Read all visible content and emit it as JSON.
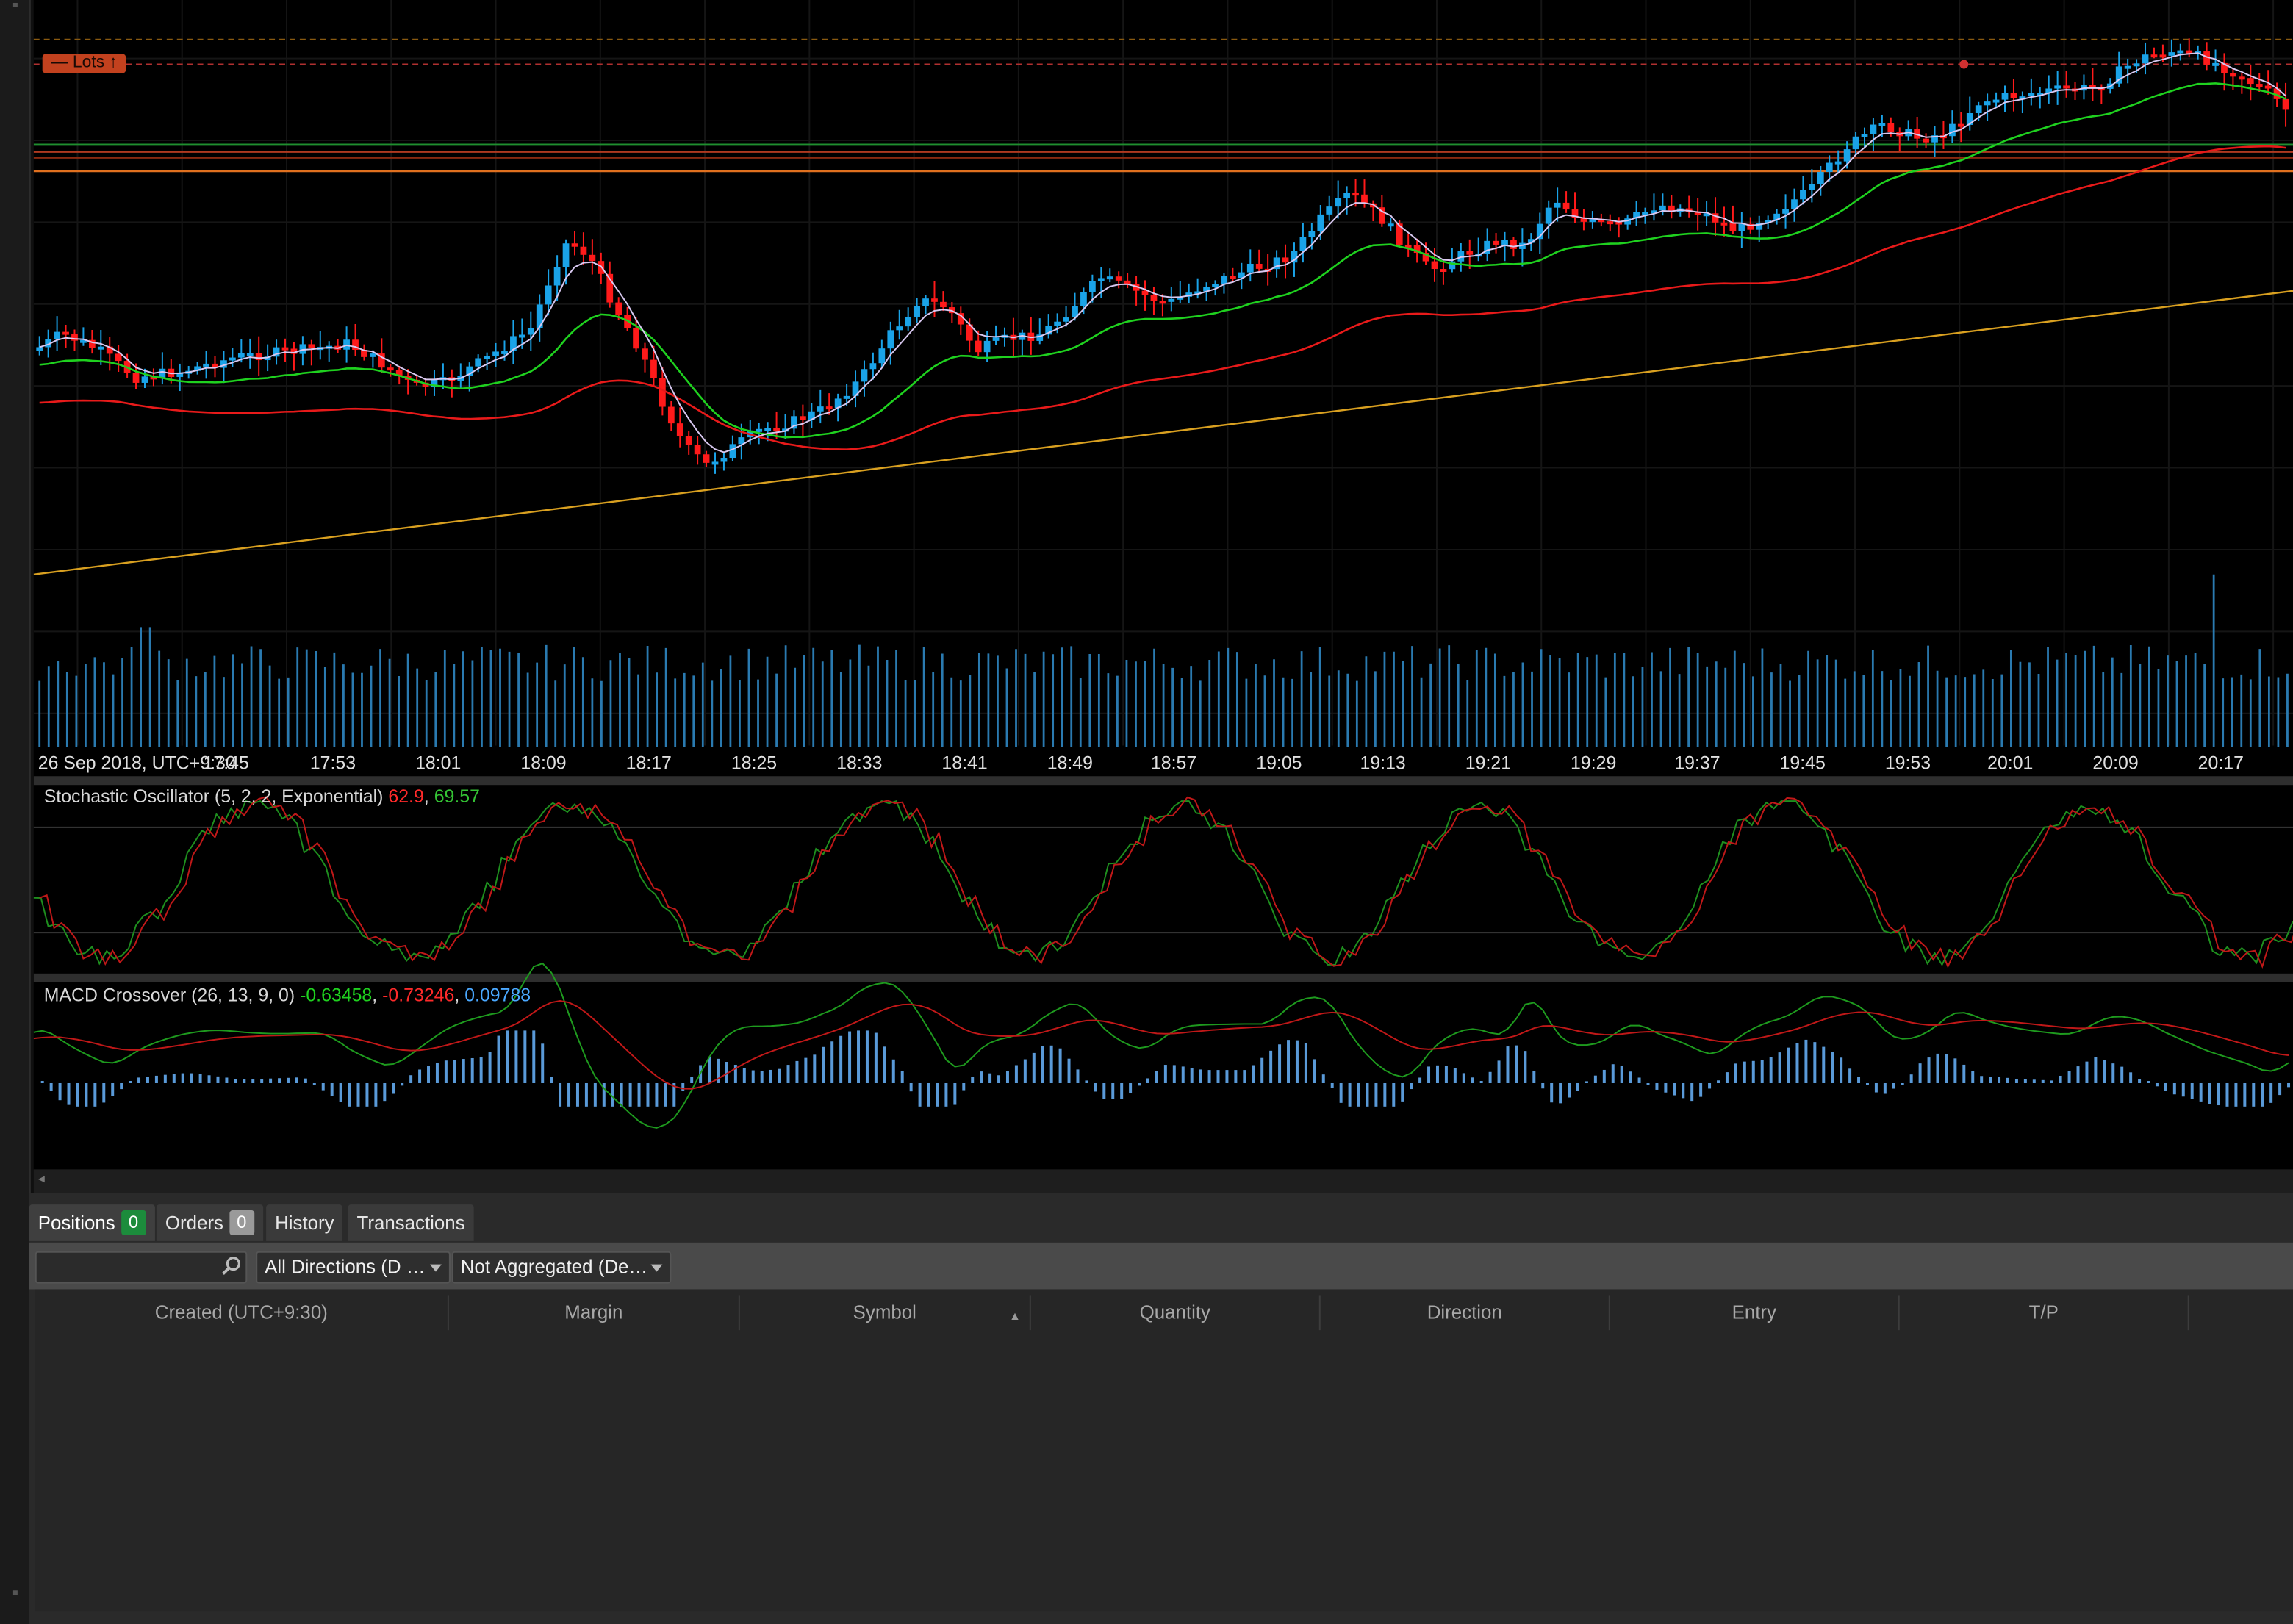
{
  "chart": {
    "date_label": "26 Sep 2018, UTC+9:30",
    "time_ticks": [
      "17:45",
      "17:53",
      "18:01",
      "18:09",
      "18:17",
      "18:25",
      "18:33",
      "18:41",
      "18:49",
      "18:57",
      "19:05",
      "19:13",
      "19:21",
      "19:29",
      "19:37",
      "19:45",
      "19:53",
      "20:01",
      "20:09",
      "20:17"
    ],
    "lots_tag": "— Lots",
    "lots_arrow": "↑",
    "colors": {
      "bull": "#1aa3e8",
      "bear": "#ff1a1a",
      "ma_fast": "#d8c8f0",
      "ma_mid": "#1fd11f",
      "ma_slow": "#e81a1a",
      "trendline": "#d9a020",
      "hline_orange": "#e0701f",
      "hline_green": "#1f8f2f",
      "volume": "#2a7ab0"
    }
  },
  "stochastic": {
    "label": "Stochastic Oscillator (5, 2, 2, Exponential)",
    "value_k": "62.9",
    "sep": ",",
    "value_d": "69.57"
  },
  "macd": {
    "label": "MACD Crossover (26, 13, 9, 0)",
    "macd": "-0.63458",
    "signal": "-0.73246",
    "hist": "0.09788",
    "sep1": ",",
    "sep2": ","
  },
  "scroll_arrow": "◂",
  "tabs": [
    {
      "label": "Positions",
      "badge": "0"
    },
    {
      "label": "Orders",
      "badge": "0"
    },
    {
      "label": "History"
    },
    {
      "label": "Transactions"
    }
  ],
  "filters": {
    "direction": "All Directions (D …",
    "aggregation": "Not Aggregated (De…"
  },
  "table": {
    "columns": [
      "Created  (UTC+9:30)",
      "Margin",
      "Symbol",
      "Quantity",
      "Direction",
      "Entry",
      "T/P"
    ],
    "sorted_column": "Symbol",
    "sort_indicator": "▲"
  }
}
